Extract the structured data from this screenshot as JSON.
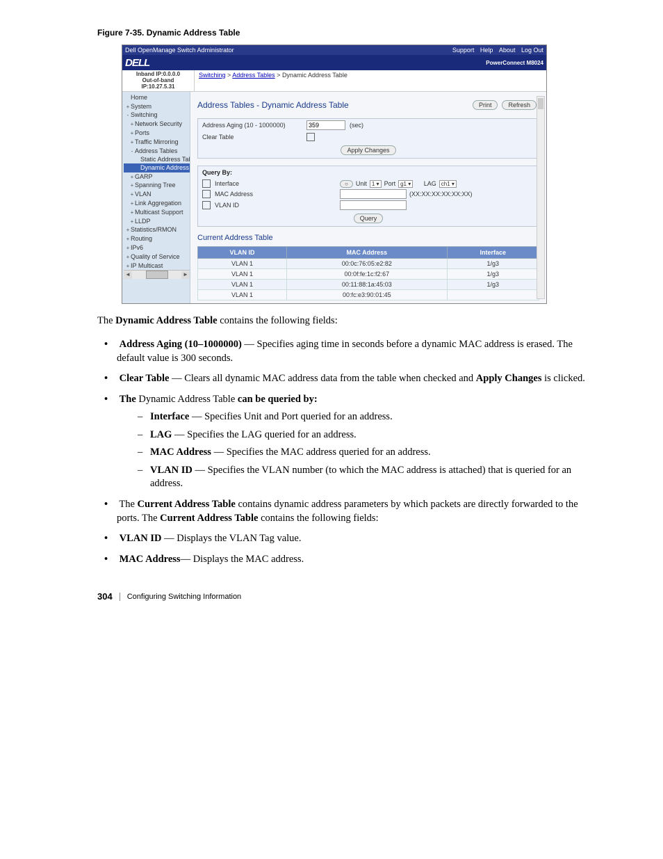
{
  "figure_caption": "Figure 7-35.    Dynamic Address Table",
  "titlebar": {
    "title": "Dell OpenManage Switch Administrator",
    "links": [
      "Support",
      "Help",
      "About",
      "Log Out"
    ]
  },
  "brandbar": {
    "logo": "DELL",
    "model": "PowerConnect M8024"
  },
  "ipbox": {
    "line1": "Inband IP:0.0.0.0",
    "line2": "Out-of-band IP:10.27.5.31"
  },
  "breadcrumb": {
    "l1": "Switching",
    "l2": "Address Tables",
    "l3": "Dynamic Address Table"
  },
  "sidebar": [
    {
      "icon": "",
      "label": "Home",
      "indent": 0
    },
    {
      "icon": "+",
      "label": "System",
      "indent": 0
    },
    {
      "icon": "-",
      "label": "Switching",
      "indent": 0
    },
    {
      "icon": "+",
      "label": "Network Security",
      "indent": 1
    },
    {
      "icon": "+",
      "label": "Ports",
      "indent": 1
    },
    {
      "icon": "+",
      "label": "Traffic Mirroring",
      "indent": 1
    },
    {
      "icon": "-",
      "label": "Address Tables",
      "indent": 1
    },
    {
      "icon": "",
      "label": "Static Address Tab",
      "indent": 2
    },
    {
      "icon": "",
      "label": "Dynamic Address",
      "indent": 2,
      "active": true
    },
    {
      "icon": "+",
      "label": "GARP",
      "indent": 1
    },
    {
      "icon": "+",
      "label": "Spanning Tree",
      "indent": 1
    },
    {
      "icon": "+",
      "label": "VLAN",
      "indent": 1
    },
    {
      "icon": "+",
      "label": "Link Aggregation",
      "indent": 1
    },
    {
      "icon": "+",
      "label": "Multicast Support",
      "indent": 1
    },
    {
      "icon": "+",
      "label": "LLDP",
      "indent": 1
    },
    {
      "icon": "+",
      "label": "Statistics/RMON",
      "indent": 0
    },
    {
      "icon": "+",
      "label": "Routing",
      "indent": 0
    },
    {
      "icon": "+",
      "label": "IPv6",
      "indent": 0
    },
    {
      "icon": "+",
      "label": "Quality of Service",
      "indent": 0
    },
    {
      "icon": "+",
      "label": "IP Multicast",
      "indent": 0
    }
  ],
  "content": {
    "title": "Address Tables - Dynamic Address Table",
    "print_btn": "Print",
    "refresh_btn": "Refresh",
    "aging_label": "Address Aging (10 - 1000000)",
    "aging_value": "359",
    "aging_unit": "(sec)",
    "clear_label": "Clear Table",
    "apply_btn": "Apply Changes",
    "query_by_header": "Query By:",
    "q_interface": "Interface",
    "q_unit_lbl": "Unit",
    "q_unit_val": "1",
    "q_port_lbl": "Port",
    "q_port_val": "g1",
    "q_lag_lbl": "LAG",
    "q_lag_val": "ch1",
    "q_mac": "MAC Address",
    "q_mac_hint": "(XX:XX:XX:XX:XX:XX)",
    "q_vlan": "VLAN ID",
    "query_btn": "Query",
    "current_title": "Current Address Table",
    "table_headers": [
      "VLAN ID",
      "MAC Address",
      "Interface"
    ],
    "table_rows": [
      [
        "VLAN 1",
        "00:0c:76:05:e2:82",
        "1/g3"
      ],
      [
        "VLAN 1",
        "00:0f:fe:1c:f2:67",
        "1/g3"
      ],
      [
        "VLAN 1",
        "00:11:88:1a:45:03",
        "1/g3"
      ],
      [
        "VLAN 1",
        "00:fc:e3:90:01:45",
        ""
      ]
    ]
  },
  "doc": {
    "intro_pre": "The ",
    "intro_bold": "Dynamic Address Table",
    "intro_post": " contains the following fields:",
    "b1_bold": "Address Aging (10–1000000)",
    "b1_rest": " — Specifies aging time in seconds before a dynamic MAC address is erased. The default value is 300 seconds.",
    "b2_bold": "Clear Table",
    "b2_mid": " — Clears all dynamic MAC address data from the table when checked and ",
    "b2_bold2": "Apply Changes",
    "b2_end": " is clicked.",
    "b3_pre": "The ",
    "b3_mid": "Dynamic Address Table ",
    "b3_bold2": "can be queried by:",
    "s1_bold": "Interface",
    "s1_rest": " — Specifies Unit and Port queried for an address.",
    "s2_bold": "LAG",
    "s2_rest": " — Specifies the LAG queried for an address.",
    "s3_bold": "MAC Address",
    "s3_rest": " — Specifies the MAC address queried for an address.",
    "s4_bold": "VLAN ID",
    "s4_rest": " — Specifies the VLAN number (to which the MAC address is attached) that is queried for an address.",
    "b4_pre": "The ",
    "b4_bold": "Current Address Table",
    "b4_mid": " contains dynamic address parameters by which packets are directly forwarded to the ports. The ",
    "b4_bold2": "Current Address Table",
    "b4_end": " contains the following fields:",
    "b5_bold": "VLAN ID",
    "b5_rest": " — Displays the VLAN Tag value.",
    "b6_bold": "MAC Address",
    "b6_rest": "— Displays the MAC address."
  },
  "footer": {
    "page": "304",
    "section": "Configuring Switching Information"
  }
}
